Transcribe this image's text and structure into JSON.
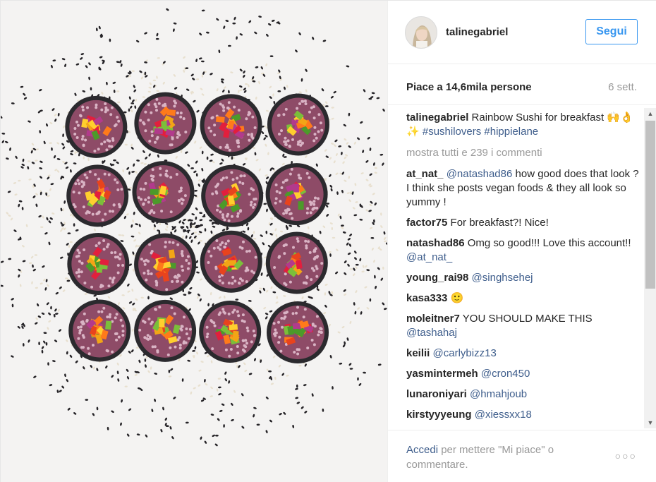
{
  "post": {
    "username": "talinegabriel",
    "follow_label": "Segui",
    "likes": "Piace a 14,6mila persone",
    "date": "6 sett.",
    "caption": {
      "user": "talinegabriel",
      "text": "Rainbow Sushi for breakfast 🙌👌✨",
      "tags": [
        "#sushilovers",
        "#hippielane"
      ]
    },
    "view_all": "mostra tutti e 239 i commenti",
    "comments": [
      {
        "user": "at_nat_",
        "mention": "@natashad86",
        "text": " how good does that look ? I think she posts vegan foods & they all look so yummy !"
      },
      {
        "user": "factor75",
        "mention": "",
        "text": "For breakfast?! Nice!"
      },
      {
        "user": "natashad86",
        "mention": "",
        "text": "Omg so good!!! Love this account!! ",
        "trailing_mention": "@at_nat_"
      },
      {
        "user": "young_rai98",
        "mention": "@singhsehej",
        "text": ""
      },
      {
        "user": "kasa333",
        "mention": "",
        "text": "🙂"
      },
      {
        "user": "moleitner7",
        "mention": "",
        "text": "YOU SHOULD MAKE THIS ",
        "trailing_mention": "@tashahaj"
      },
      {
        "user": "keilii",
        "mention": "@carlybizz13",
        "text": ""
      },
      {
        "user": "yasmintermeh",
        "mention": "@cron450",
        "text": ""
      },
      {
        "user": "lunaroniyari",
        "mention": "@hmahjoub",
        "text": ""
      },
      {
        "user": "kirstyyyeung",
        "mention": "@xiessxx18",
        "text": ""
      }
    ],
    "footer": {
      "login_label": "Accedi",
      "rest": " per mettere \"Mi piace\" o commentare."
    },
    "more_options": "○○○"
  },
  "colors": {
    "link": "#3f5e8c",
    "follow": "#3897f0",
    "muted": "#999999",
    "roll_nori": "#2b2a2e",
    "roll_rice": "#8e4b67"
  },
  "photo": {
    "subject": "grid of rainbow sushi rolls on sesame seeds",
    "rolls_rows": 4,
    "rolls_cols": 4
  }
}
